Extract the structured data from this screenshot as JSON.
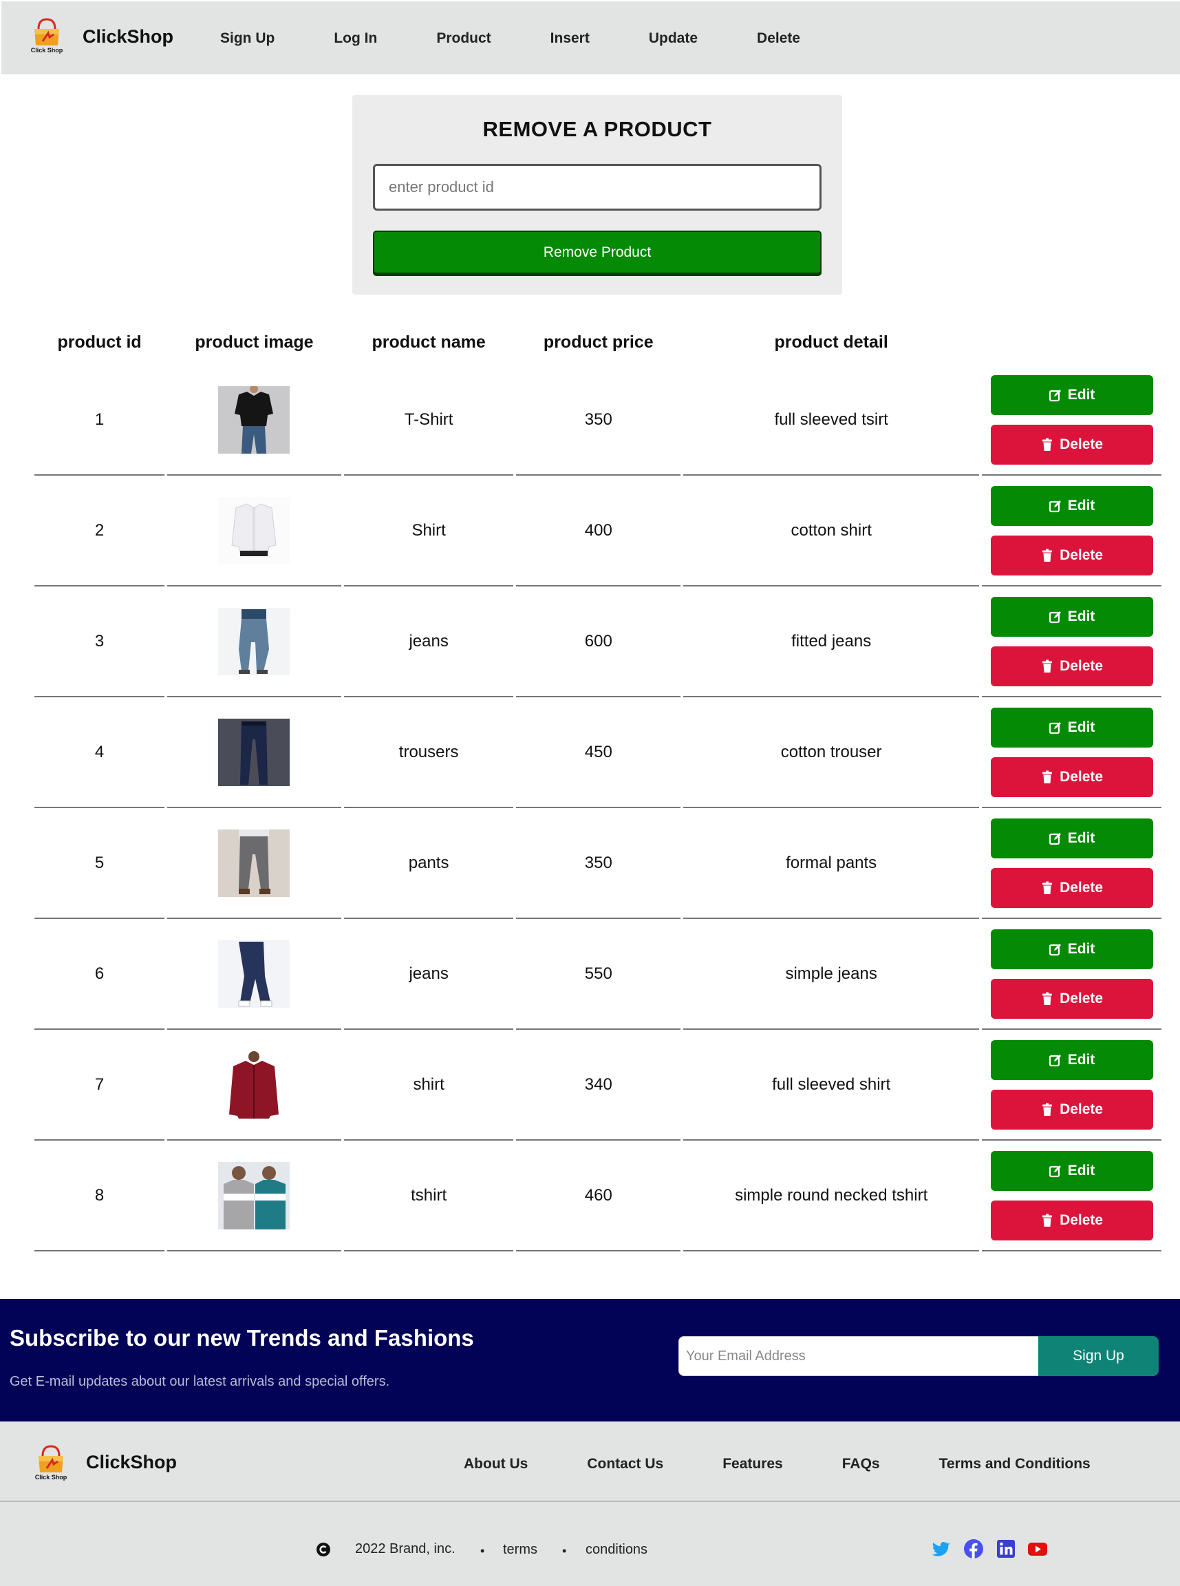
{
  "brand": {
    "name": "ClickShop",
    "logo_text": "Click Shop",
    "accent_orange": "#f0a020",
    "accent_red": "#d62a22"
  },
  "nav": {
    "items": [
      {
        "label": "Sign Up"
      },
      {
        "label": "Log In"
      },
      {
        "label": "Product"
      },
      {
        "label": "Insert"
      },
      {
        "label": "Update"
      },
      {
        "label": "Delete"
      }
    ]
  },
  "remove_panel": {
    "title": "REMOVE A PRODUCT",
    "input_placeholder": "enter product id",
    "input_value": "",
    "button_label": "Remove Product"
  },
  "table": {
    "headers": [
      "product id",
      "product image",
      "product name",
      "product price",
      "product detail"
    ],
    "edit_label": "Edit",
    "delete_label": "Delete",
    "rows": [
      {
        "id": "1",
        "image": "black-tshirt-photo",
        "name": "T-Shirt",
        "price": "350",
        "detail": "full sleeved tsirt"
      },
      {
        "id": "2",
        "image": "white-shirt-photo",
        "name": "Shirt",
        "price": "400",
        "detail": "cotton shirt"
      },
      {
        "id": "3",
        "image": "blue-jeans-photo",
        "name": "jeans",
        "price": "600",
        "detail": "fitted jeans"
      },
      {
        "id": "4",
        "image": "navy-trousers-photo",
        "name": "trousers",
        "price": "450",
        "detail": "cotton trouser"
      },
      {
        "id": "5",
        "image": "grey-pants-photo",
        "name": "pants",
        "price": "350",
        "detail": "formal pants"
      },
      {
        "id": "6",
        "image": "dark-jeans-photo",
        "name": "jeans",
        "price": "550",
        "detail": "simple jeans"
      },
      {
        "id": "7",
        "image": "red-shirt-photo",
        "name": "shirt",
        "price": "340",
        "detail": "full sleeved shirt"
      },
      {
        "id": "8",
        "image": "striped-tshirts-photo",
        "name": "tshirt",
        "price": "460",
        "detail": "simple round necked tshirt"
      }
    ]
  },
  "subscribe": {
    "title": "Subscribe to our new Trends and Fashions",
    "text": "Get E-mail updates about our latest arrivals and special offers.",
    "input_placeholder": "Your Email Address",
    "button_label": "Sign Up",
    "bg_color": "#020257",
    "button_color": "#0f8376"
  },
  "footer": {
    "brand": "ClickShop",
    "links": [
      {
        "label": "About Us"
      },
      {
        "label": "Contact Us"
      },
      {
        "label": "Features"
      },
      {
        "label": "FAQs"
      },
      {
        "label": "Terms and Conditions"
      }
    ],
    "copyright": "2022 Brand, inc.",
    "terms": "terms",
    "conditions": "conditions",
    "social": [
      "twitter-icon",
      "facebook-icon",
      "linkedin-icon",
      "youtube-icon"
    ]
  },
  "colors": {
    "edit_green": "#058a05",
    "delete_red": "#dc143c"
  }
}
